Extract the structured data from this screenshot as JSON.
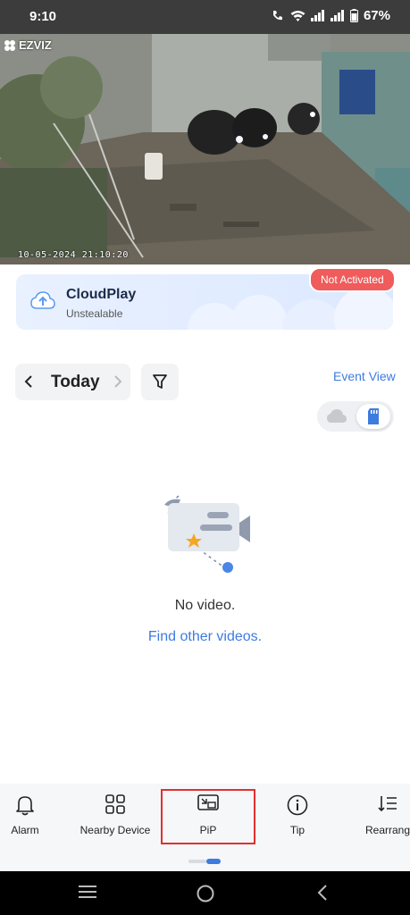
{
  "status_bar": {
    "time": "9:10",
    "battery": "67%"
  },
  "camera": {
    "brand": "EZVIZ",
    "timestamp": "10-05-2024 21:10:20"
  },
  "cloudplay": {
    "title": "CloudPlay",
    "subtitle": "Unstealable",
    "badge": "Not Activated"
  },
  "date_nav": {
    "label": "Today"
  },
  "event_view": "Event View",
  "empty_state": {
    "message": "No video.",
    "link": "Find other videos."
  },
  "toolbar": {
    "items": [
      {
        "label": "Alarm",
        "icon": "bell-icon"
      },
      {
        "label": "Nearby Device",
        "icon": "grid-icon"
      },
      {
        "label": "PiP",
        "icon": "pip-icon"
      },
      {
        "label": "Tip",
        "icon": "info-icon"
      },
      {
        "label": "Rearrange",
        "icon": "rearrange-icon"
      }
    ]
  },
  "colors": {
    "accent": "#3d7be0",
    "badge": "#f05b5b",
    "highlight": "#e0302f"
  }
}
